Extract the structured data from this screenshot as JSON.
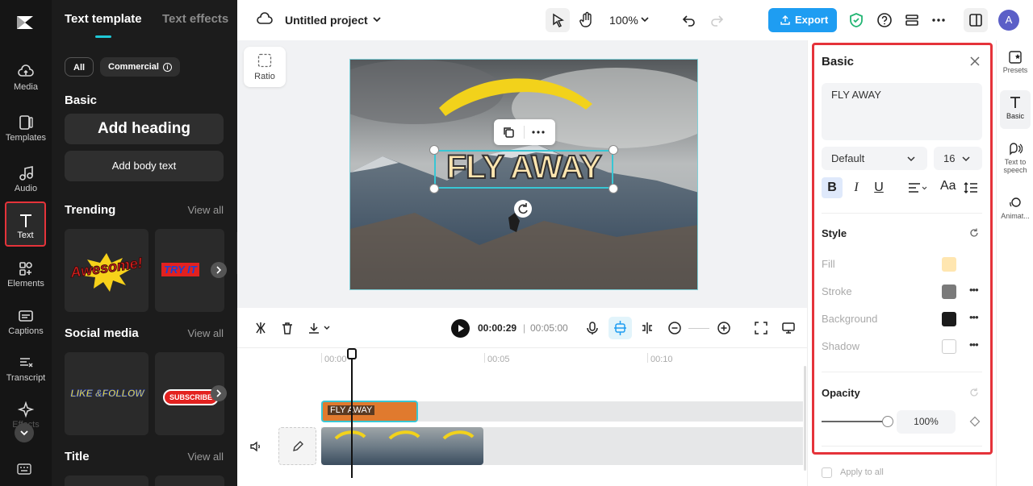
{
  "rail": {
    "items": [
      {
        "label": "Media"
      },
      {
        "label": "Templates"
      },
      {
        "label": "Audio"
      },
      {
        "label": "Text"
      },
      {
        "label": "Elements"
      },
      {
        "label": "Captions"
      },
      {
        "label": "Transcript"
      },
      {
        "label": "Effects"
      }
    ]
  },
  "panel": {
    "tabs": [
      "Text template",
      "Text effects"
    ],
    "filters": [
      "All",
      "Commercial"
    ],
    "basic": {
      "title": "Basic",
      "add_heading": "Add heading",
      "add_body": "Add body text"
    },
    "trending": {
      "title": "Trending",
      "view_all": "View all",
      "cards": [
        "Awesome!",
        "TRY IT"
      ]
    },
    "social": {
      "title": "Social media",
      "view_all": "View all",
      "cards": [
        "LIKE &FOLLOW",
        "SUBSCRIBE"
      ]
    },
    "title_section": {
      "title": "Title",
      "view_all": "View all"
    }
  },
  "topbar": {
    "project_name": "Untitled project",
    "zoom": "100%",
    "export_label": "Export",
    "avatar": "A"
  },
  "canvas": {
    "ratio_label": "Ratio",
    "text_overlay": "FLY AWAY"
  },
  "playback": {
    "current": "00:00:29",
    "separator": "|",
    "total": "00:05:00"
  },
  "timeline": {
    "ticks": [
      "00:00",
      "00:05",
      "00:10"
    ],
    "text_clip": "FLY AWAY"
  },
  "right_panel": {
    "title": "Basic",
    "text_value": "FLY AWAY",
    "font": "Default",
    "size": "16",
    "style_title": "Style",
    "fill": "Fill",
    "stroke": "Stroke",
    "background": "Background",
    "shadow": "Shadow",
    "opacity_title": "Opacity",
    "opacity_value": "100%",
    "opacity_level": 1.0,
    "apply_all": "Apply to all",
    "colors": {
      "fill": "#ffe6b0",
      "stroke": "#7a7a7a",
      "background": "#1b1b1b",
      "shadow": "#ffffff"
    }
  },
  "side_tabs": [
    "Presets",
    "Basic",
    "Text to speech",
    "Animat..."
  ],
  "colors": {
    "accent": "#1e9df2",
    "highlight": "#e5333a",
    "clip": "#e07a2e",
    "shield": "#22b573"
  }
}
